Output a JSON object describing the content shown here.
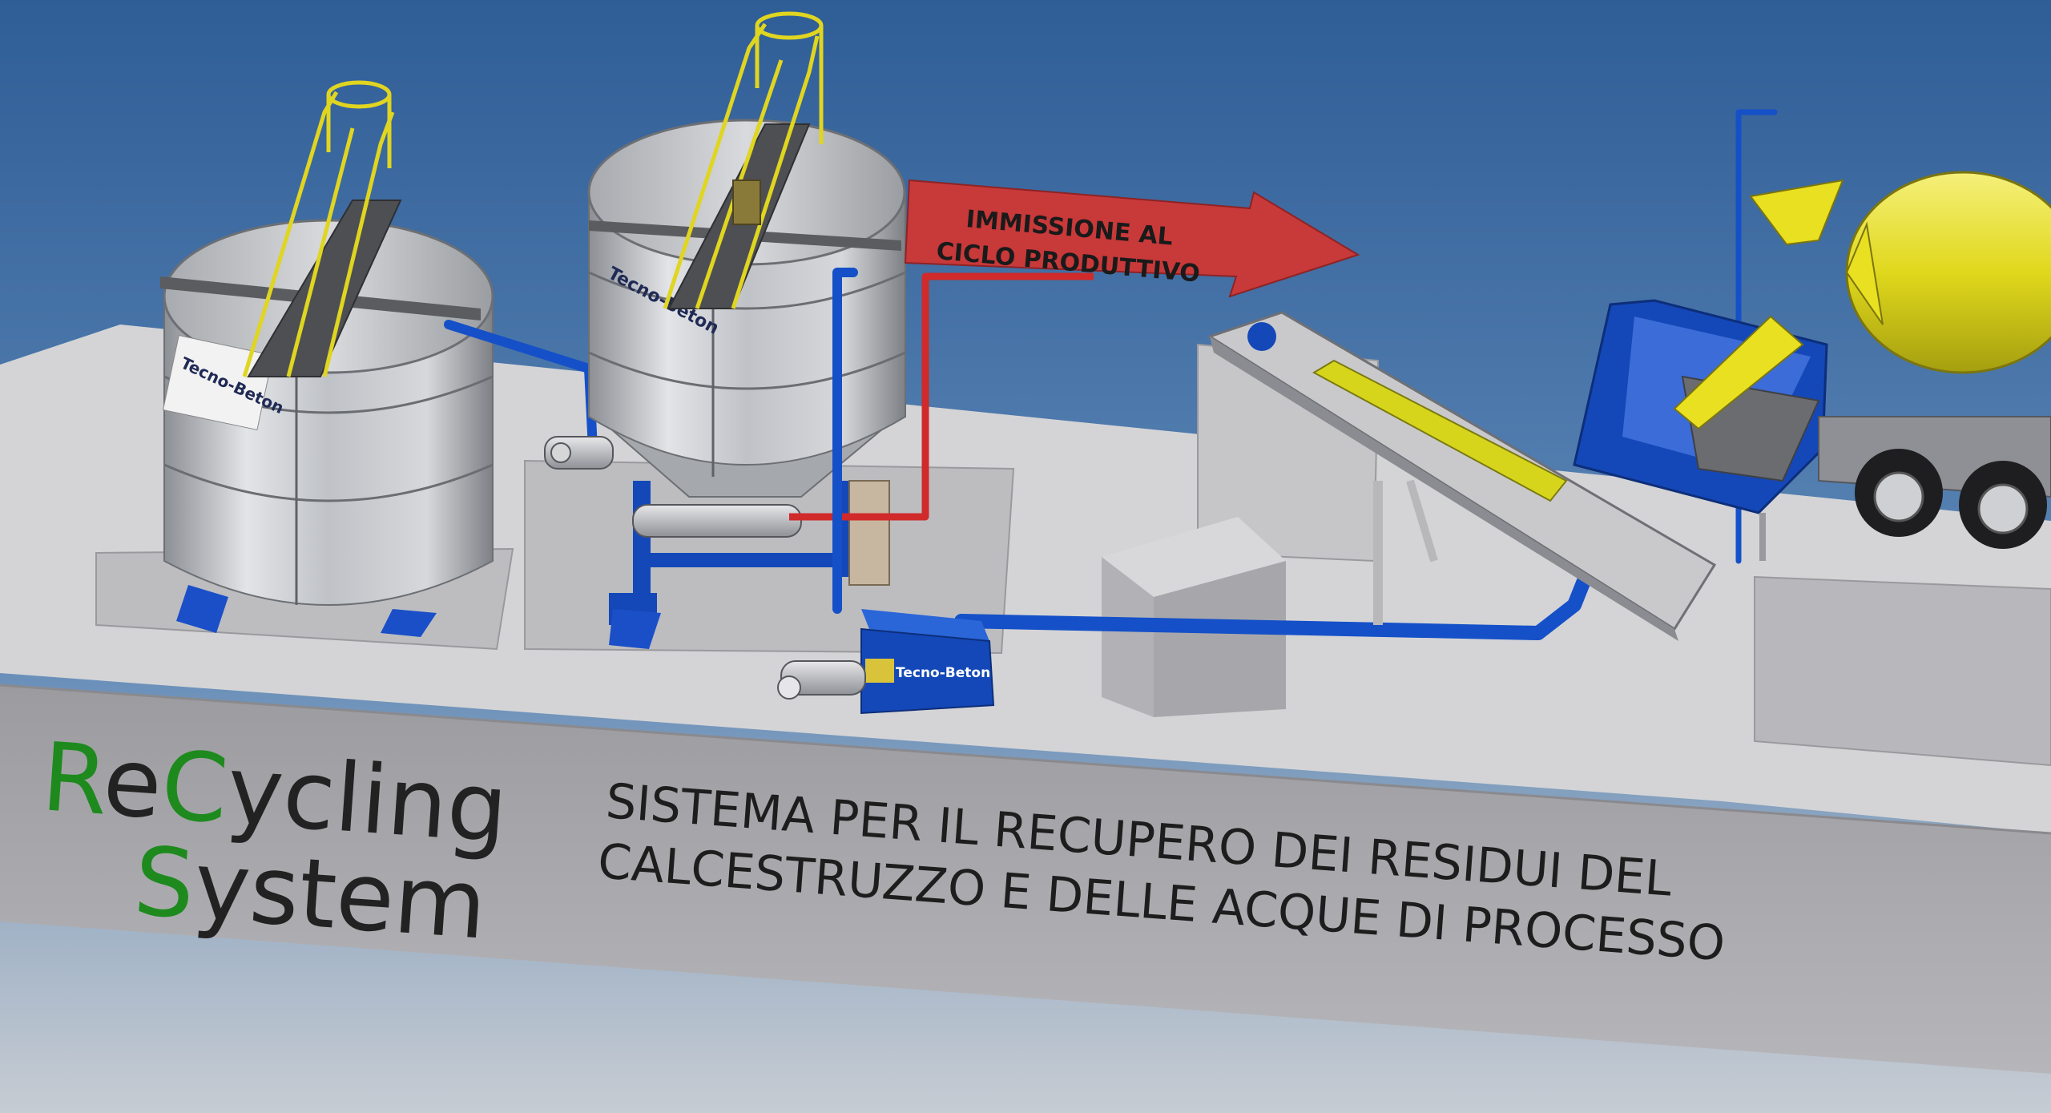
{
  "flow_arrow": {
    "line1": "IMMISSIONE AL",
    "line2": "CICLO PRODUTTIVO",
    "color": "#c8393a"
  },
  "tanks": [
    {
      "brand_label": "Tecno-Beton"
    },
    {
      "brand_label": "Tecno-Beton"
    }
  ],
  "pump_box": {
    "brand_label": "Tecno-Beton"
  },
  "logo": {
    "line1": [
      {
        "text": "R",
        "color": "#1e8a1e"
      },
      {
        "text": "e",
        "color": "#222222"
      },
      {
        "text": "C",
        "color": "#1e8a1e"
      },
      {
        "text": "ycling",
        "color": "#222222"
      }
    ],
    "line2": [
      {
        "text": "S",
        "color": "#1e8a1e"
      },
      {
        "text": "ystem",
        "color": "#222222"
      }
    ]
  },
  "description": {
    "line1": "SISTEMA PER IL RECUPERO DEI RESIDUI DEL",
    "line2": "CALCESTRUZZO E DELLE ACQUE DI PROCESSO"
  },
  "colors": {
    "pipe_blue": "#1550c8",
    "frame_blue": "#1448b8",
    "pipe_red": "#d02a2a",
    "railing_yellow": "#e0d520",
    "mixer_yellow": "#e8e020",
    "platform_gray": "#d4d4d6"
  }
}
